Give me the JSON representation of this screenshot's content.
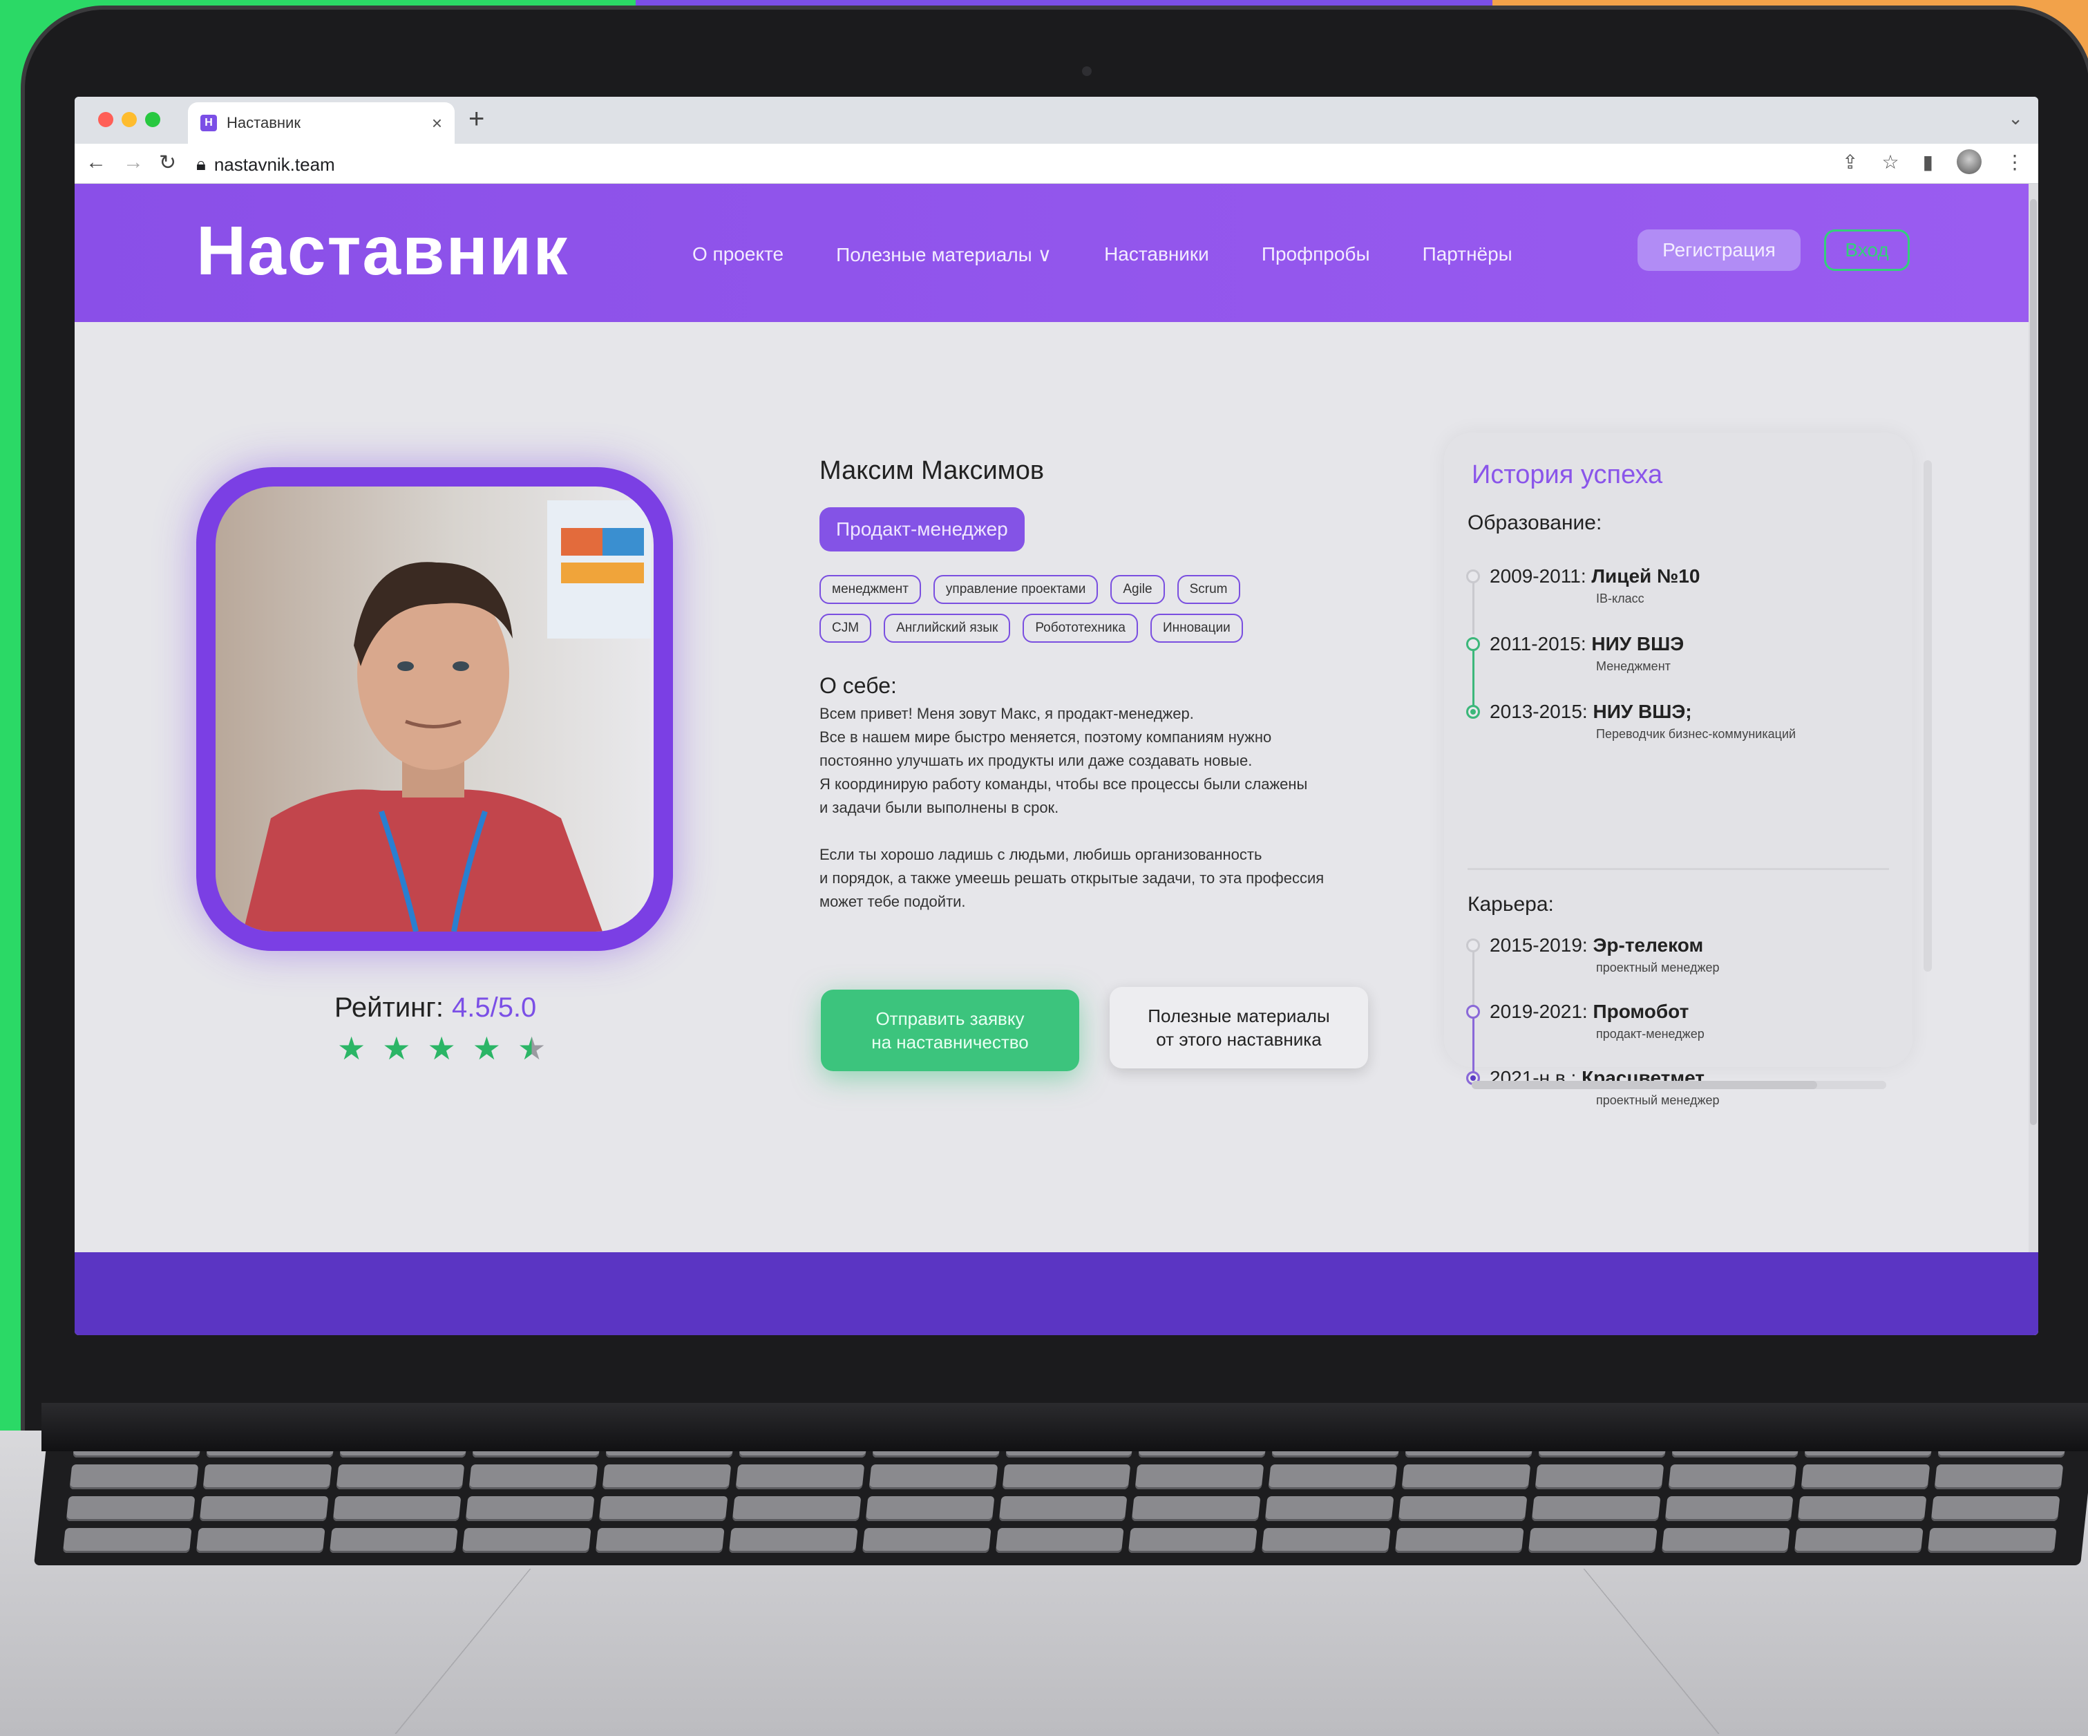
{
  "browser": {
    "tab_title": "Наставник",
    "tab_close": "×",
    "new_tab": "+",
    "url": "nastavnik.team",
    "icons": [
      "back-icon",
      "forward-icon",
      "reload-icon",
      "lock-icon",
      "share-icon",
      "star-icon",
      "sidebar-icon",
      "profile-icon",
      "menu-icon"
    ]
  },
  "header": {
    "logo": "Наставник",
    "menu": [
      "О проекте",
      "Полезные материалы ∨",
      "Наставники",
      "Профпробы",
      "Партнёры"
    ],
    "register": "Регистрация",
    "login": "Вход"
  },
  "profile": {
    "name": "Максим Максимов",
    "role": "Продакт-менеджер",
    "tags": [
      "менеджмент",
      "управление проектами",
      "Agile",
      "Scrum",
      "CJM",
      "Английский язык",
      "Робототехника",
      "Инновации"
    ],
    "about_heading": "О себе:",
    "about_p1": "Всем привет! Меня зовут Макс, я продакт-менеджер.\nВсе в нашем мире быстро меняется, поэтому компаниям нужно\nпостоянно улучшать их продукты или даже создавать новые.\nЯ координирую работу команды, чтобы все процессы были слажены\nи задачи были выполнены в срок.",
    "about_p2": "Если ты хорошо ладишь с людьми, любишь организованность\nи порядок, а также умеешь решать открытые задачи, то эта профессия\nможет тебе подойти.",
    "rating_label": "Рейтинг:",
    "rating_value": "4.5/5.0",
    "rating_stars": 4.5,
    "apply_button": "Отправить заявку\nна наставничество",
    "materials_button": "Полезные материалы\nот этого наставника"
  },
  "history": {
    "title": "История успеха",
    "education_heading": "Образование:",
    "education": [
      {
        "years": "2009-2011:",
        "place": "Лицей №10",
        "detail": "IB-класс"
      },
      {
        "years": "2011-2015:",
        "place": "НИУ ВШЭ",
        "detail": "Менеджмент"
      },
      {
        "years": "2013-2015:",
        "place": "НИУ ВШЭ;",
        "detail": "Переводчик бизнес-коммуникаций"
      }
    ],
    "career_heading": "Карьера:",
    "career": [
      {
        "years": "2015-2019:",
        "place": "Эр-телеком",
        "detail": "проектный менеджер"
      },
      {
        "years": "2019-2021:",
        "place": "Промобот",
        "detail": "продакт-менеджер"
      },
      {
        "years": "2021-н.в.:",
        "place": "Красцветмет",
        "detail": "проектный менеджер"
      }
    ]
  },
  "colors": {
    "brand_violet": "#8a4fe8",
    "accent_green": "#3cc47d"
  }
}
